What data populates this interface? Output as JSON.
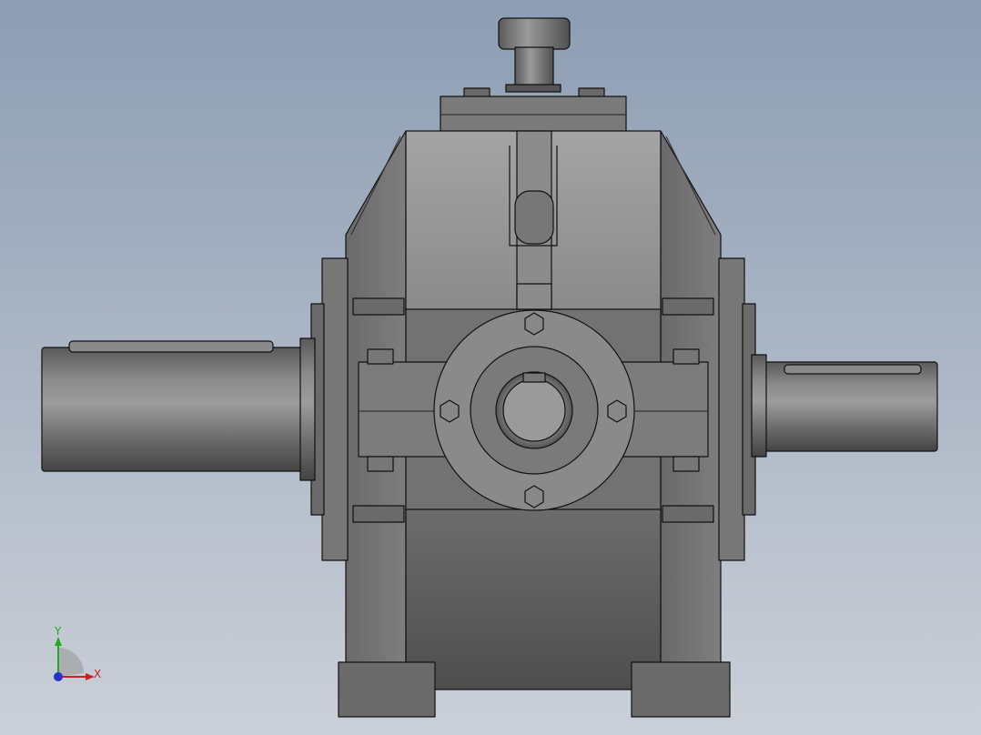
{
  "viewport": {
    "background_top": "#8d9db3",
    "background_bottom": "#c9cfd8"
  },
  "model": {
    "name": "gearbox-front-view",
    "body_color": "#6e6e6e",
    "light_color": "#9a9a9a",
    "dark_color": "#4a4a4a",
    "edge_color": "#111111"
  },
  "triad": {
    "x_label": "X",
    "y_label": "Y",
    "x_color": "#cc2222",
    "y_color": "#22aa22",
    "z_color": "#2233cc"
  }
}
